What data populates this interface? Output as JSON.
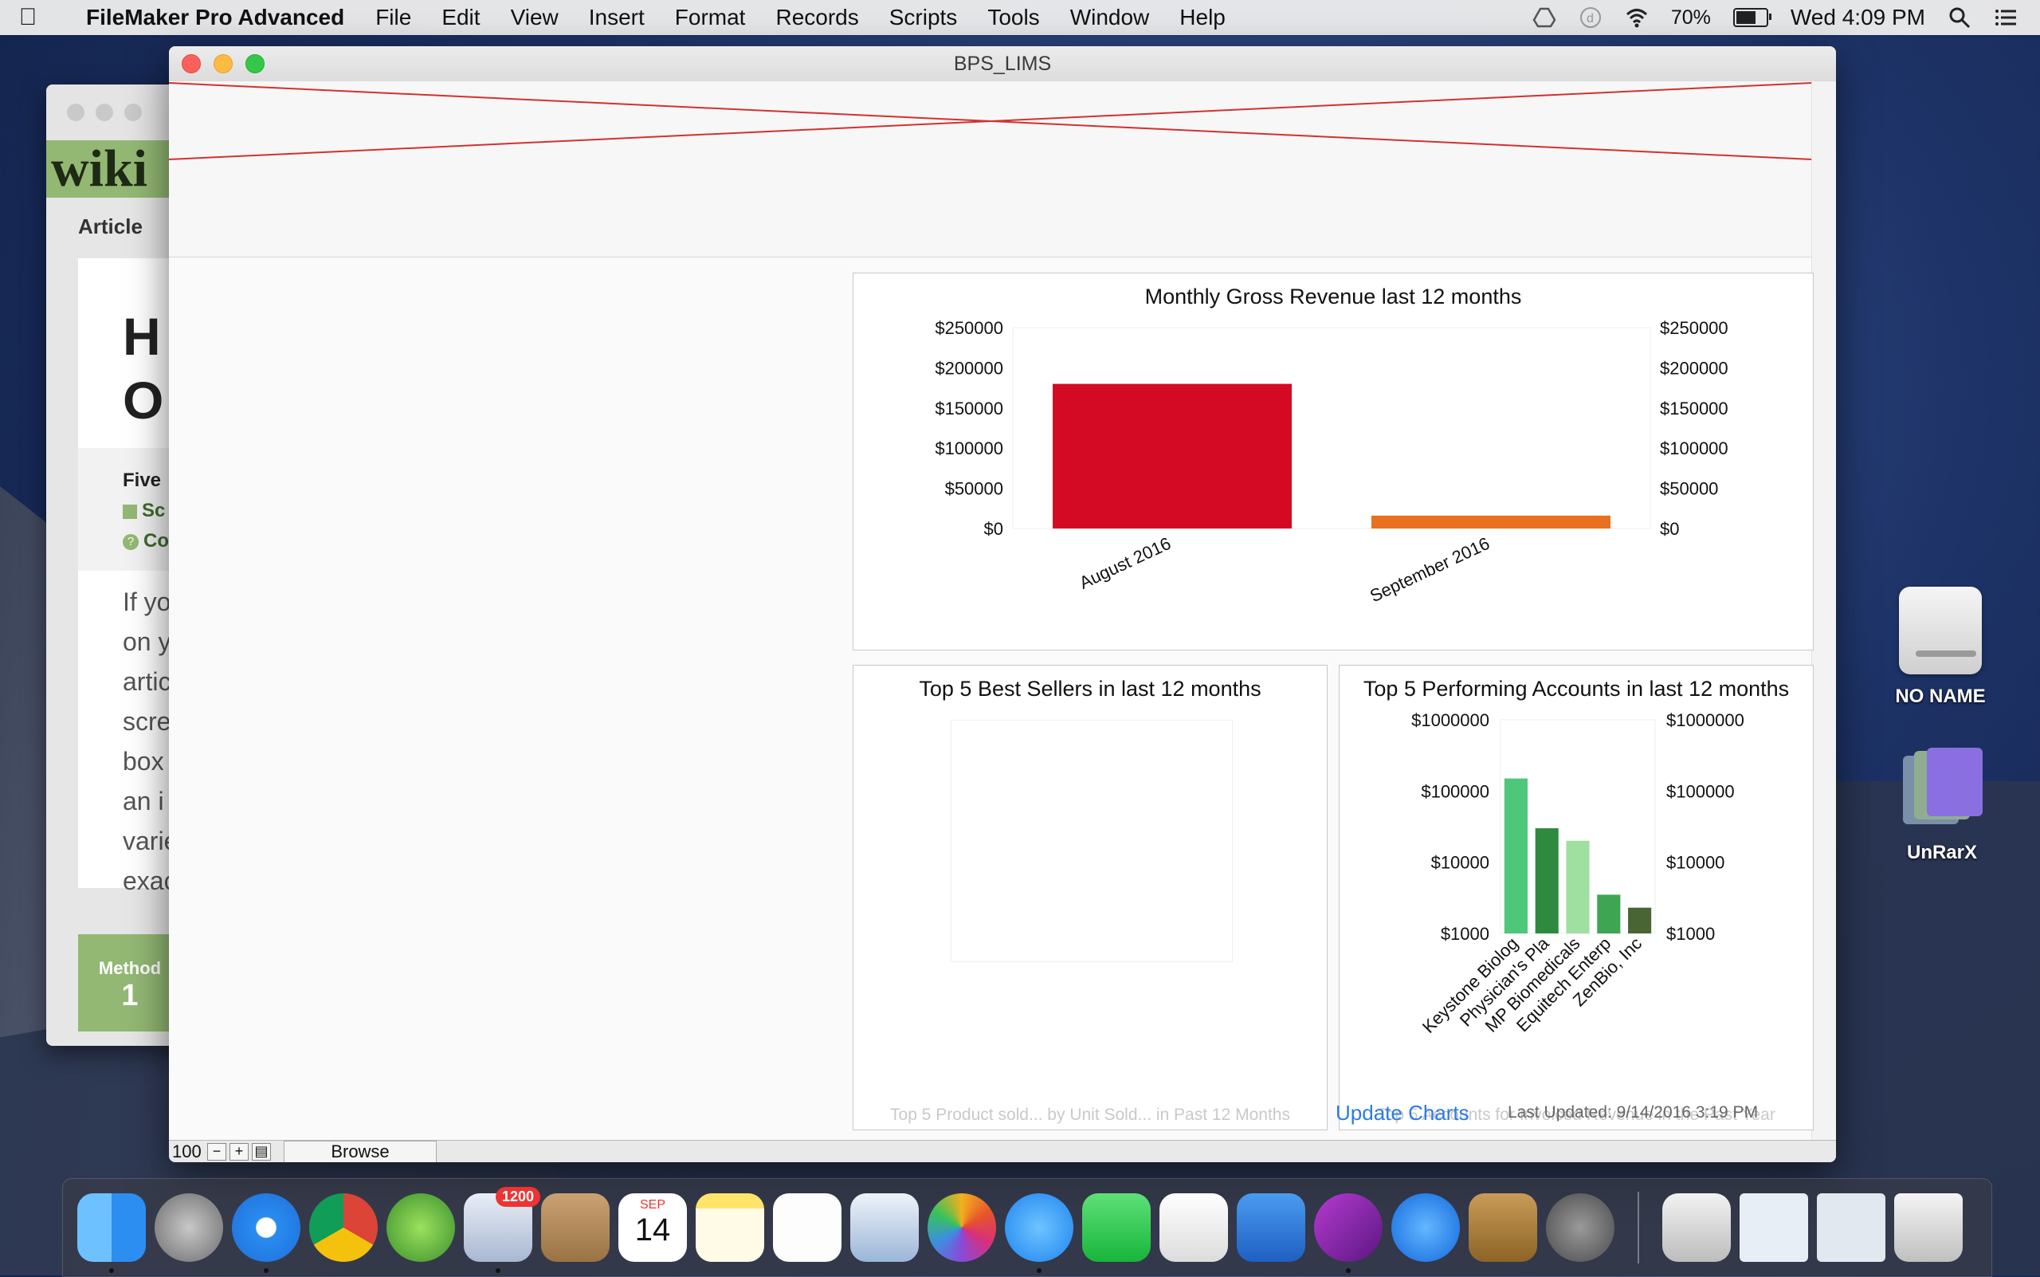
{
  "menubar": {
    "app_name": "FileMaker Pro Advanced",
    "menus": [
      "File",
      "Edit",
      "View",
      "Insert",
      "Format",
      "Records",
      "Scripts",
      "Tools",
      "Window",
      "Help"
    ],
    "battery": "70%",
    "battery_level": 0.7,
    "clock": "Wed 4:09 PM"
  },
  "background_window": {
    "banner": "wiki",
    "tab": "Article",
    "heading_line1": "H",
    "heading_line2": "O",
    "summary_title": "Five",
    "summary_item1": "Sc",
    "summary_item2": "Co",
    "paragraph": [
      "If yo",
      "on y",
      "artic",
      "scre",
      "box",
      "an i",
      "varie",
      "exac"
    ],
    "method_label": "Method",
    "method_number": "1"
  },
  "window": {
    "title": "BPS_LIMS"
  },
  "charts": {
    "revenue_title": "Monthly Gross Revenue last 12 months",
    "sellers_title": "Top 5 Best Sellers in last 12 months",
    "sellers_footer": "Top 5 Product sold... by Unit Sold... in Past 12 Months",
    "accounts_title": "Top 5 Performing Accounts in last 12 months",
    "accounts_footer": "Top 5 Accounts for Invoiced Revenue in the Past Year"
  },
  "chart_data": [
    {
      "type": "bar",
      "title": "Monthly Gross Revenue last 12 months",
      "categories": [
        "August 2016",
        "September 2016"
      ],
      "values": [
        180000,
        16000
      ],
      "colors": [
        "#d40a24",
        "#e8701f"
      ],
      "yticks": [
        "$0",
        "$50000",
        "$100000",
        "$150000",
        "$200000",
        "$250000"
      ],
      "ylim": [
        0,
        250000
      ],
      "grid": false
    },
    {
      "type": "bar",
      "title": "Top 5 Best Sellers in last 12 months",
      "categories": [],
      "values": []
    },
    {
      "type": "bar",
      "title": "Top 5 Performing Accounts in last 12 months",
      "categories": [
        "Keystone Biolog",
        "Physician's Pla",
        "MP Biomedicals",
        "Equitech Enterp",
        "ZenBio, Inc"
      ],
      "values": [
        150000,
        30000,
        20000,
        3500,
        2300
      ],
      "colors": [
        "#4ec77a",
        "#2d8a3e",
        "#9fdf9f",
        "#3ea553",
        "#4a6534"
      ],
      "yticks": [
        "$1000",
        "$10000",
        "$100000",
        "$1000000"
      ],
      "ylim": [
        1000,
        1000000
      ],
      "scale": "log",
      "grid": false
    }
  ],
  "actions": {
    "update_label": "Update Charts",
    "last_updated": "Last Updated: 9/14/2016 3:19 PM"
  },
  "statusbar": {
    "zoom": "100",
    "mode": "Browse"
  },
  "desktop": {
    "icon1": "NO NAME",
    "icon2": "UnRarX"
  },
  "dock": {
    "mail_badge": "1200",
    "calendar_month": "SEP",
    "calendar_day": "14"
  }
}
